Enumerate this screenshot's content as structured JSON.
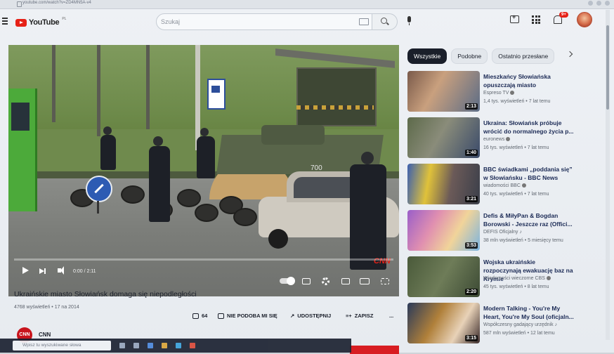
{
  "browser": {
    "url": "youtube.com/watch?v=ZD4MN5A-v4"
  },
  "header": {
    "logo_text": "YouTube",
    "logo_region": "PL",
    "search_placeholder": "Szukaj",
    "notifications_count": "9+"
  },
  "video": {
    "time": "0:00 / 2:11",
    "progress_fraction": 0.0,
    "watermark": "CNN",
    "apc_number": "700"
  },
  "title": "Ukraińskie miasto Słowiańsk domaga się niepodległości",
  "meta": "4768 wyświetleń • 17 na 2014",
  "actions": {
    "likes": "64",
    "dislike": "NIE PODOBA MI SIĘ",
    "share": "UDOSTĘPNIJ",
    "save": "ZAPISZ",
    "more": "..."
  },
  "channel": {
    "name": "CNN",
    "avatar_text": "CNN"
  },
  "taskbar": {
    "search_placeholder": "Wpisz tu wyszukiwane słowa"
  },
  "chips": [
    "Wszystkie",
    "Podobne",
    "Ostatnio przesłane"
  ],
  "recommendations": [
    {
      "title": "Mieszkańcy Słowiańska opuszczają miasto",
      "channel": "Espreso TV",
      "meta": "1,4 tys. wyświetleń • 7 lat temu",
      "duration": "2:13"
    },
    {
      "title": "Ukraina: Słowiańsk próbuje wrócić do normalnego życia p...",
      "channel": "euronews",
      "meta": "16 tys. wyświetleń • 7 lat temu",
      "duration": "1:40"
    },
    {
      "title": "BBC świadkami „poddania się” w Słowiańsku - BBC News",
      "channel": "wiadomości BBC",
      "meta": "40 tys. wyświetleń • 7 lat temu",
      "duration": "3:21"
    },
    {
      "title": "Defis & MiłyPan & Bogdan Borowski - Jeszcze raz (Offici...",
      "channel": "DEFIS Oficjalny",
      "meta": "38 mln wyświetleń • 5 miesięcy temu",
      "duration": "3:53"
    },
    {
      "title": "Wojska ukraińskie rozpoczynają ewakuację baz na Krymie",
      "channel": "Wiadomości wieczorne CBS",
      "meta": "45 tys. wyświetleń • 8 lat temu",
      "duration": "2:20"
    },
    {
      "title": "Modern Talking - You're My Heart, You're My Soul (oficjaln...",
      "channel": "Współczesny gadający urzędnik",
      "meta": "587 mln wyświetleń • 12 lat temu",
      "duration": "3:15"
    }
  ],
  "colors": {
    "accent": "#e62117",
    "chip_active": "#1a1f2a"
  }
}
